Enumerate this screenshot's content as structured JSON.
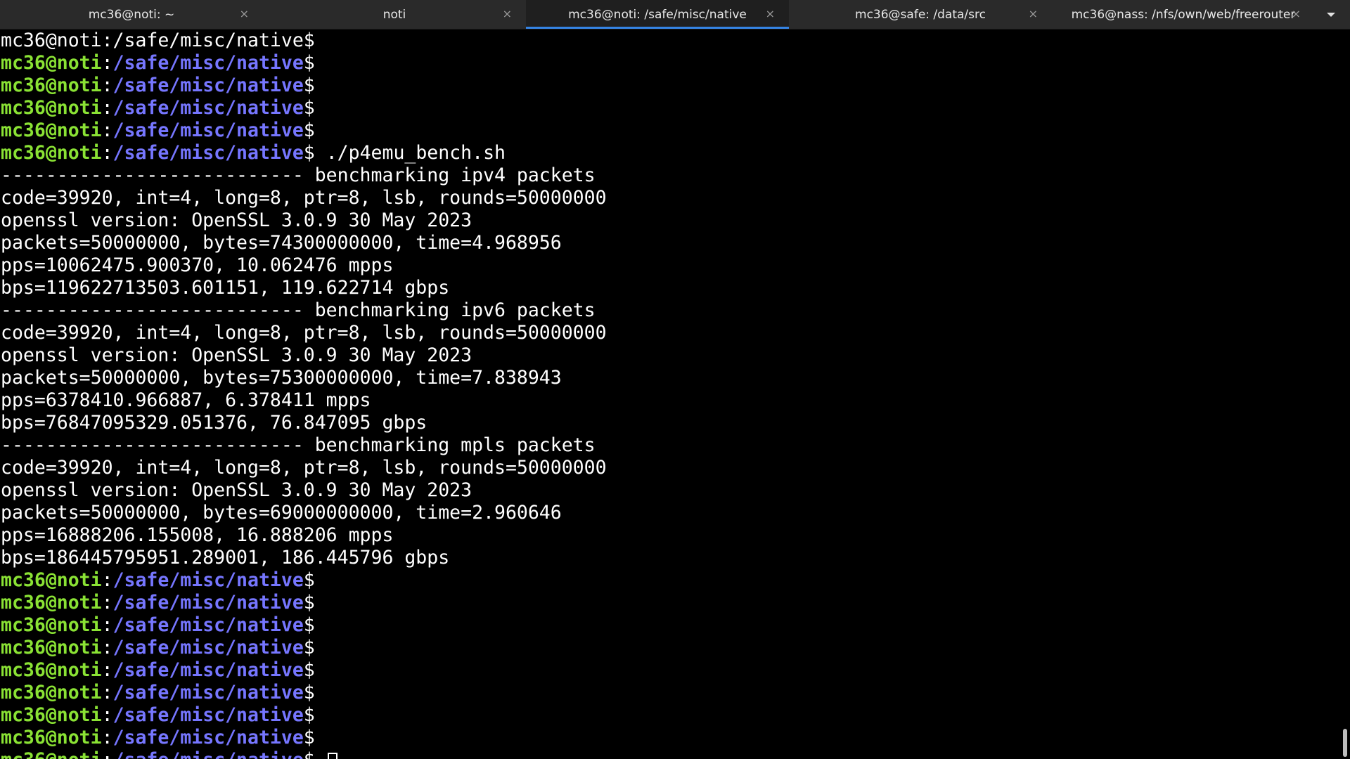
{
  "tabs": [
    {
      "label": "mc36@noti: ~",
      "close": "×",
      "active": false
    },
    {
      "label": "noti",
      "close": "×",
      "active": false
    },
    {
      "label": "mc36@noti: /safe/misc/native",
      "close": "×",
      "active": true
    },
    {
      "label": "mc36@safe: /data/src",
      "close": "×",
      "active": false
    },
    {
      "label": "mc36@nass: /nfs/own/web/freerouter",
      "close": "×",
      "active": false
    }
  ],
  "tab_menu_icon": "chevron-down-icon",
  "prompt": {
    "user": "mc36@noti",
    "colon": ":",
    "path": "/safe/misc/native",
    "symbol": "$"
  },
  "lines": [
    {
      "type": "plain",
      "text": "mc36@noti:/safe/misc/native$"
    },
    {
      "type": "prompt",
      "cmd": ""
    },
    {
      "type": "prompt",
      "cmd": ""
    },
    {
      "type": "prompt",
      "cmd": ""
    },
    {
      "type": "prompt",
      "cmd": ""
    },
    {
      "type": "prompt",
      "cmd": " ./p4emu_bench.sh"
    },
    {
      "type": "plain",
      "text": "--------------------------- benchmarking ipv4 packets"
    },
    {
      "type": "plain",
      "text": "code=39920, int=4, long=8, ptr=8, lsb, rounds=50000000"
    },
    {
      "type": "plain",
      "text": "openssl version: OpenSSL 3.0.9 30 May 2023"
    },
    {
      "type": "plain",
      "text": "packets=50000000, bytes=74300000000, time=4.968956"
    },
    {
      "type": "plain",
      "text": "pps=10062475.900370, 10.062476 mpps"
    },
    {
      "type": "plain",
      "text": "bps=119622713503.601151, 119.622714 gbps"
    },
    {
      "type": "plain",
      "text": "--------------------------- benchmarking ipv6 packets"
    },
    {
      "type": "plain",
      "text": "code=39920, int=4, long=8, ptr=8, lsb, rounds=50000000"
    },
    {
      "type": "plain",
      "text": "openssl version: OpenSSL 3.0.9 30 May 2023"
    },
    {
      "type": "plain",
      "text": "packets=50000000, bytes=75300000000, time=7.838943"
    },
    {
      "type": "plain",
      "text": "pps=6378410.966887, 6.378411 mpps"
    },
    {
      "type": "plain",
      "text": "bps=76847095329.051376, 76.847095 gbps"
    },
    {
      "type": "plain",
      "text": "--------------------------- benchmarking mpls packets"
    },
    {
      "type": "plain",
      "text": "code=39920, int=4, long=8, ptr=8, lsb, rounds=50000000"
    },
    {
      "type": "plain",
      "text": "openssl version: OpenSSL 3.0.9 30 May 2023"
    },
    {
      "type": "plain",
      "text": "packets=50000000, bytes=69000000000, time=2.960646"
    },
    {
      "type": "plain",
      "text": "pps=16888206.155008, 16.888206 mpps"
    },
    {
      "type": "plain",
      "text": "bps=186445795951.289001, 186.445796 gbps"
    },
    {
      "type": "prompt",
      "cmd": ""
    },
    {
      "type": "prompt",
      "cmd": ""
    },
    {
      "type": "prompt",
      "cmd": ""
    },
    {
      "type": "prompt",
      "cmd": ""
    },
    {
      "type": "prompt",
      "cmd": ""
    },
    {
      "type": "prompt",
      "cmd": ""
    },
    {
      "type": "prompt",
      "cmd": ""
    },
    {
      "type": "prompt",
      "cmd": ""
    },
    {
      "type": "prompt",
      "cmd": " ",
      "cursor": true
    }
  ],
  "colors": {
    "background": "#000000",
    "user": "#8ae234",
    "path": "#7676ff",
    "text": "#ffffff",
    "tab_active_underline": "#3584e4"
  }
}
